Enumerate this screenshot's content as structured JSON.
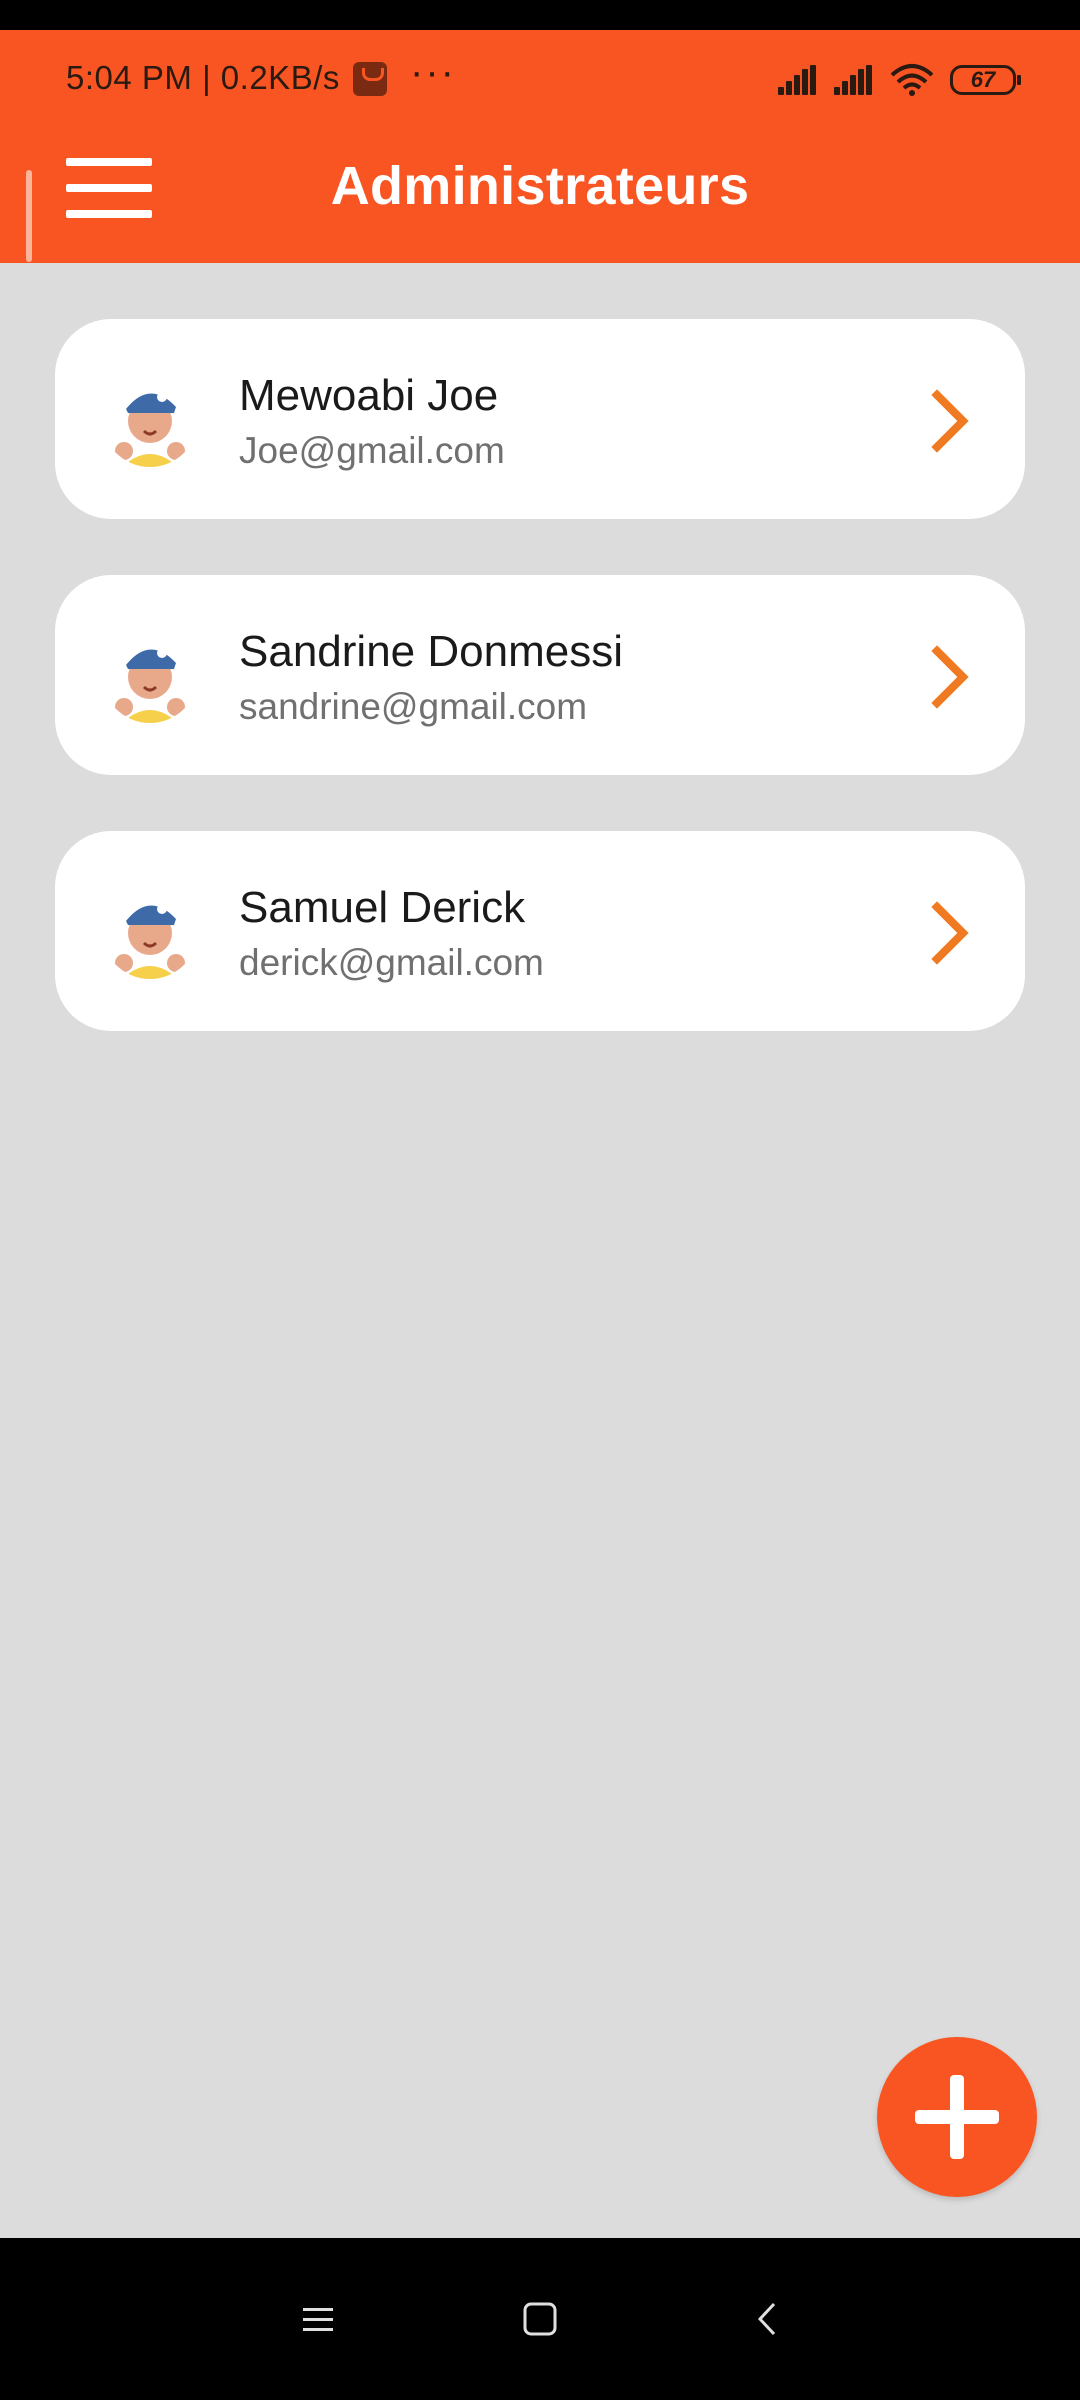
{
  "status_bar": {
    "time": "5:04 PM | 0.2KB/s",
    "more_dots": "···",
    "battery_level": "67",
    "app_icon": "mi-store-icon"
  },
  "header": {
    "title": "Administrateurs",
    "menu_icon": "menu-icon",
    "background_color": "#f95522"
  },
  "admins": [
    {
      "name": "Mewoabi Joe",
      "email": "Joe@gmail.com",
      "avatar": "cartoon-avatar",
      "action_icon": "chevron-right-icon"
    },
    {
      "name": "Sandrine Donmessi",
      "email": "sandrine@gmail.com",
      "avatar": "cartoon-avatar",
      "action_icon": "chevron-right-icon"
    },
    {
      "name": "Samuel Derick",
      "email": "derick@gmail.com",
      "avatar": "cartoon-avatar",
      "action_icon": "chevron-right-icon"
    }
  ],
  "fab": {
    "icon": "plus-icon",
    "color": "#f95522"
  },
  "system_nav": {
    "recents_icon": "recents-icon",
    "home_icon": "home-icon",
    "back_icon": "back-icon"
  },
  "colors": {
    "accent": "#f95522",
    "chevron": "#f07a22",
    "page_background": "#dcdcdc"
  }
}
